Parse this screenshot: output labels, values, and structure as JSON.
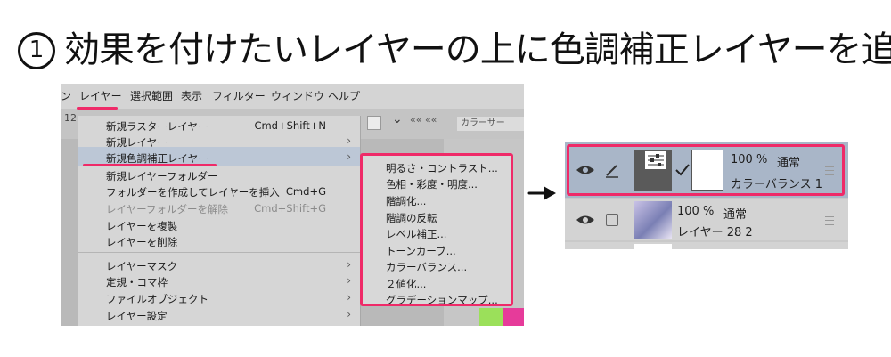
{
  "heading": {
    "number": "1",
    "text": "効果を付けたいレイヤーの上に色調補正レイヤーを追加"
  },
  "menubar": {
    "items": [
      "ン",
      "レイヤー",
      "選択範囲",
      "表示",
      "フィルター",
      "ウィンドウ",
      "ヘルプ"
    ]
  },
  "layer_menu": {
    "items": [
      {
        "label": "新規ラスターレイヤー",
        "shortcut": "Cmd+Shift+N"
      },
      {
        "label": "新規レイヤー",
        "submenu": true
      },
      {
        "label": "新規色調補正レイヤー",
        "submenu": true,
        "highlighted": true
      },
      {
        "label": "新規レイヤーフォルダー"
      },
      {
        "label": "フォルダーを作成してレイヤーを挿入",
        "shortcut": "Cmd+G"
      },
      {
        "label": "レイヤーフォルダーを解除",
        "shortcut": "Cmd+Shift+G",
        "disabled": true
      },
      {
        "label": "レイヤーを複製"
      },
      {
        "label": "レイヤーを削除"
      },
      {
        "label": "レイヤーマスク",
        "submenu": true
      },
      {
        "label": "定規・コマ枠",
        "submenu": true
      },
      {
        "label": "ファイルオブジェクト",
        "submenu": true
      },
      {
        "label": "レイヤー設定",
        "submenu": true
      }
    ]
  },
  "adjustment_submenu": {
    "items": [
      "明るさ・コントラスト...",
      "色相・彩度・明度...",
      "階調化...",
      "階調の反転",
      "レベル補正...",
      "トーンカーブ...",
      "カラーバランス...",
      "２値化...",
      "グラデーションマップ..."
    ]
  },
  "background_fragments": {
    "canvas_tab": "カラーサー",
    "zoom_hint": "12"
  },
  "layer_panel": {
    "layers": [
      {
        "opacity": "100 %",
        "blend": "通常",
        "name": "カラーバランス 1",
        "selected": true
      },
      {
        "opacity": "100 %",
        "blend": "通常",
        "name": "レイヤー 28 2"
      }
    ]
  },
  "colors": {
    "highlight_accent": "#ef2a68",
    "selected_row": "#a9b6c8",
    "menu_bg": "#d6d6d6"
  }
}
